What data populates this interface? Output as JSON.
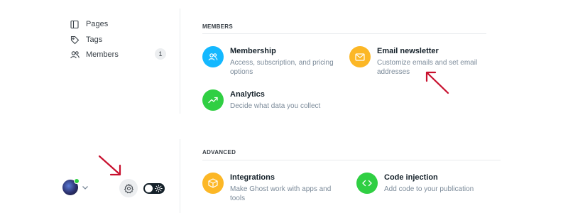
{
  "sidebar": {
    "items": [
      {
        "label": "Pages",
        "icon": "pages-icon"
      },
      {
        "label": "Tags",
        "icon": "tag-icon"
      },
      {
        "label": "Members",
        "icon": "members-icon",
        "count": "1"
      }
    ]
  },
  "members_section": {
    "title": "MEMBERS",
    "cards": [
      {
        "title": "Membership",
        "description": "Access, subscription, and pricing options",
        "icon": "members-icon",
        "color": "#14b8ff"
      },
      {
        "title": "Email newsletter",
        "description": "Customize emails and set email addresses",
        "icon": "email-icon",
        "color": "#fcb726"
      },
      {
        "title": "Analytics",
        "description": "Decide what data you collect",
        "icon": "trend-up-icon",
        "color": "#30cf43"
      }
    ]
  },
  "advanced_section": {
    "title": "ADVANCED",
    "cards": [
      {
        "title": "Integrations",
        "description": "Make Ghost work with apps and tools",
        "icon": "box-icon",
        "color": "#fcb726"
      },
      {
        "title": "Code injection",
        "description": "Add code to your publication",
        "icon": "code-icon",
        "color": "#30cf43"
      }
    ]
  },
  "footer": {
    "status_color": "#30cf43",
    "toggle_state": "off"
  },
  "annotation_color": "#c8102e"
}
